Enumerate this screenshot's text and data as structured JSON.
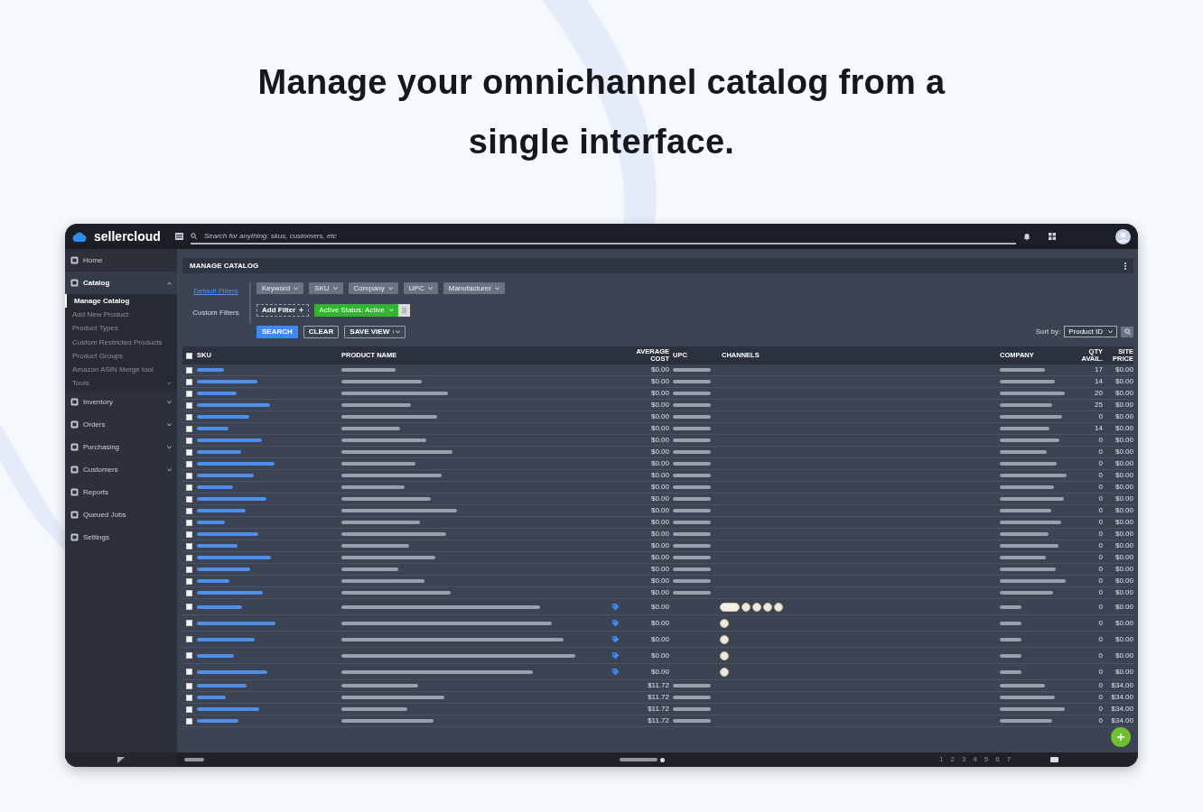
{
  "headline": "Manage your omnichannel catalog from a single interface.",
  "app": {
    "logo": "sellercloud",
    "search": {
      "placeholder": "Search for anything: skus, customers, etc"
    },
    "sidebar": [
      {
        "label": "Home",
        "kind": "link",
        "selected": false
      },
      {
        "label": "Catalog",
        "kind": "group",
        "selected": true,
        "expanded": true,
        "children": [
          {
            "label": "Manage Catalog",
            "kind": "link",
            "selected": true
          },
          {
            "label": "Add New Product",
            "kind": "link",
            "selected": false
          },
          {
            "label": "Product Types",
            "kind": "link",
            "selected": false
          },
          {
            "label": "Custom Restricted Products",
            "kind": "link",
            "selected": false
          },
          {
            "label": "Product Groups",
            "kind": "link",
            "selected": false
          },
          {
            "label": "Amazon ASIN Merge tool",
            "kind": "link",
            "selected": false
          },
          {
            "label": "Tools",
            "kind": "group",
            "selected": false,
            "expanded": false
          }
        ]
      },
      {
        "label": "Inventory",
        "kind": "group",
        "selected": false,
        "expanded": false
      },
      {
        "label": "Orders",
        "kind": "group",
        "selected": false,
        "expanded": false
      },
      {
        "label": "Purchasing",
        "kind": "group",
        "selected": false,
        "expanded": false
      },
      {
        "label": "Customers",
        "kind": "group",
        "selected": false,
        "expanded": false
      },
      {
        "label": "Reports",
        "kind": "link",
        "selected": false
      },
      {
        "label": "Queued Jobs",
        "kind": "link",
        "selected": false
      },
      {
        "label": "Settings",
        "kind": "link",
        "selected": false
      }
    ],
    "page_title": "MANAGE CATALOG",
    "filters": {
      "default_label": "Default Filters",
      "custom_label": "Custom Filters",
      "default_filters": [
        "Keyword",
        "SKU",
        "Company",
        "UPC",
        "Manufacturer"
      ],
      "add_filter": "Add Filter",
      "active_filters": [
        {
          "label": "Active Status: Active"
        }
      ],
      "actions": [
        {
          "label": "SEARCH",
          "kind": "primary"
        },
        {
          "label": "CLEAR",
          "kind": "outline"
        },
        {
          "label": "SAVE VIEW",
          "kind": "split"
        }
      ],
      "sort": {
        "label": "Sort by:",
        "value": "Product ID"
      }
    },
    "table": {
      "header_checked": false,
      "columns": [
        "SKU",
        "PRODUCT NAME",
        "AVERAGE COST",
        "UPC",
        "CHANNELS",
        "COMPANY",
        "QTY AVAIL.",
        "SITE PRICE"
      ],
      "rows": [
        {
          "kind": "plain",
          "checked": false,
          "cost": "$0.00",
          "qty": "17",
          "price": "$0.00"
        },
        {
          "kind": "plain",
          "checked": false,
          "cost": "$0.00",
          "qty": "14",
          "price": "$0.00"
        },
        {
          "kind": "plain",
          "checked": false,
          "cost": "$0.00",
          "qty": "20",
          "price": "$0.00"
        },
        {
          "kind": "plain",
          "checked": false,
          "cost": "$0.00",
          "qty": "25",
          "price": "$0.00"
        },
        {
          "kind": "plain",
          "checked": false,
          "cost": "$0.00",
          "qty": "0",
          "price": "$0.00"
        },
        {
          "kind": "plain",
          "checked": false,
          "cost": "$0.00",
          "qty": "14",
          "price": "$0.00"
        },
        {
          "kind": "plain",
          "checked": false,
          "cost": "$0.00",
          "qty": "0",
          "price": "$0.00"
        },
        {
          "kind": "plain",
          "checked": false,
          "cost": "$0.00",
          "qty": "0",
          "price": "$0.00"
        },
        {
          "kind": "plain",
          "checked": false,
          "cost": "$0.00",
          "qty": "0",
          "price": "$0.00"
        },
        {
          "kind": "plain",
          "checked": false,
          "cost": "$0.00",
          "qty": "0",
          "price": "$0.00"
        },
        {
          "kind": "plain",
          "checked": false,
          "cost": "$0.00",
          "qty": "0",
          "price": "$0.00"
        },
        {
          "kind": "plain",
          "checked": false,
          "cost": "$0.00",
          "qty": "0",
          "price": "$0.00"
        },
        {
          "kind": "plain",
          "checked": false,
          "cost": "$0.00",
          "qty": "0",
          "price": "$0.00"
        },
        {
          "kind": "plain",
          "checked": false,
          "cost": "$0.00",
          "qty": "0",
          "price": "$0.00"
        },
        {
          "kind": "plain",
          "checked": false,
          "cost": "$0.00",
          "qty": "0",
          "price": "$0.00"
        },
        {
          "kind": "plain",
          "checked": false,
          "cost": "$0.00",
          "qty": "0",
          "price": "$0.00"
        },
        {
          "kind": "plain",
          "checked": false,
          "cost": "$0.00",
          "qty": "0",
          "price": "$0.00"
        },
        {
          "kind": "plain",
          "checked": false,
          "cost": "$0.00",
          "qty": "0",
          "price": "$0.00"
        },
        {
          "kind": "plain",
          "checked": false,
          "cost": "$0.00",
          "qty": "0",
          "price": "$0.00"
        },
        {
          "kind": "plain",
          "checked": false,
          "cost": "$0.00",
          "qty": "0",
          "price": "$0.00"
        },
        {
          "kind": "listed",
          "checked": false,
          "cost": "$0.00",
          "qty": "0",
          "price": "$0.00",
          "channel_badges": [
            {
              "kind": "pill"
            },
            {
              "kind": "round"
            },
            {
              "kind": "round"
            },
            {
              "kind": "round"
            },
            {
              "kind": "round"
            }
          ]
        },
        {
          "kind": "listed",
          "checked": false,
          "cost": "$0.00",
          "qty": "0",
          "price": "$0.00",
          "channel_badges": [
            {
              "kind": "round"
            }
          ]
        },
        {
          "kind": "listed",
          "checked": false,
          "cost": "$0.00",
          "qty": "0",
          "price": "$0.00",
          "channel_badges": [
            {
              "kind": "round"
            }
          ]
        },
        {
          "kind": "listed",
          "checked": false,
          "cost": "$0.00",
          "qty": "0",
          "price": "$0.00",
          "channel_badges": [
            {
              "kind": "round"
            }
          ]
        },
        {
          "kind": "listed",
          "checked": false,
          "cost": "$0.00",
          "qty": "0",
          "price": "$0.00",
          "channel_badges": [
            {
              "kind": "round"
            }
          ]
        },
        {
          "kind": "plain",
          "checked": false,
          "cost": "$11.72",
          "qty": "0",
          "price": "$34.00"
        },
        {
          "kind": "plain",
          "checked": false,
          "cost": "$11.72",
          "qty": "0",
          "price": "$34.00"
        },
        {
          "kind": "plain",
          "checked": false,
          "cost": "$11.72",
          "qty": "0",
          "price": "$34.00"
        },
        {
          "kind": "plain",
          "checked": false,
          "cost": "$11.72",
          "qty": "0",
          "price": "$34.00"
        }
      ]
    },
    "pagination": [
      "1",
      "2",
      "3",
      "4",
      "5",
      "6",
      "7"
    ]
  }
}
